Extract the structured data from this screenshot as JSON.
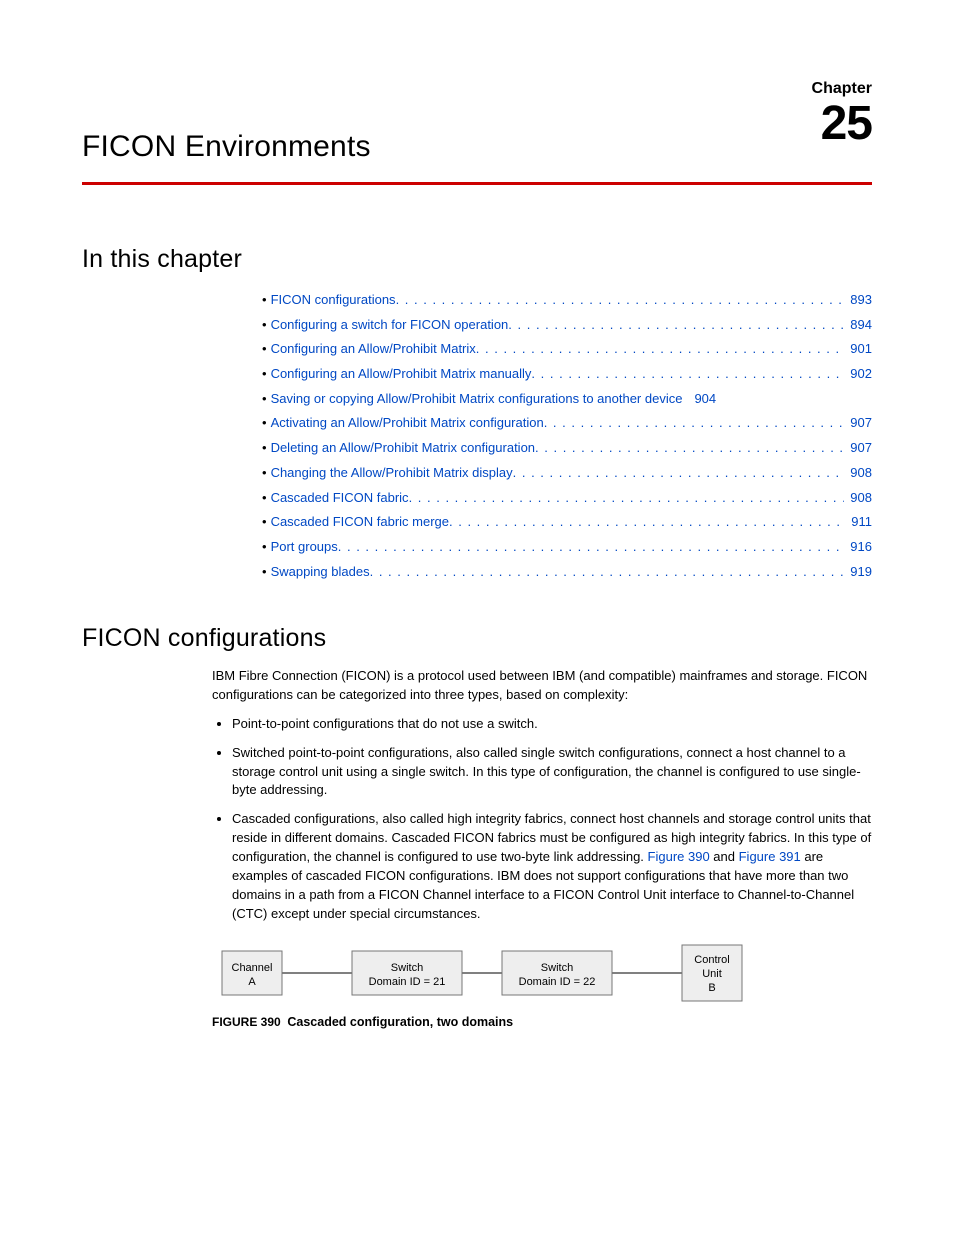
{
  "chapter": {
    "label": "Chapter",
    "number": "25",
    "title": "FICON Environments"
  },
  "toc_heading": "In this chapter",
  "toc": [
    {
      "label": "FICON configurations",
      "page": "893",
      "dots": true
    },
    {
      "label": "Configuring a switch for FICON operation",
      "page": "894",
      "dots": true
    },
    {
      "label": "Configuring an Allow/Prohibit Matrix",
      "page": "901",
      "dots": true
    },
    {
      "label": "Configuring an Allow/Prohibit Matrix manually",
      "page": "902",
      "dots": true
    },
    {
      "label": "Saving or copying Allow/Prohibit Matrix configurations to another device",
      "page": "904",
      "dots": false
    },
    {
      "label": "Activating an Allow/Prohibit Matrix configuration",
      "page": "907",
      "dots": true
    },
    {
      "label": "Deleting an Allow/Prohibit Matrix configuration",
      "page": "907",
      "dots": true
    },
    {
      "label": "Changing the Allow/Prohibit Matrix display",
      "page": "908",
      "dots": true
    },
    {
      "label": "Cascaded FICON fabric",
      "page": "908",
      "dots": true
    },
    {
      "label": "Cascaded FICON fabric merge",
      "page": "911",
      "dots": true
    },
    {
      "label": "Port groups",
      "page": "916",
      "dots": true
    },
    {
      "label": "Swapping blades",
      "page": "919",
      "dots": true
    }
  ],
  "section2_heading": "FICON configurations",
  "intro_para": "IBM Fibre Connection (FICON) is a protocol used between IBM (and compatible) mainframes and storage. FICON configurations can be categorized into three types, based on complexity:",
  "bullets": {
    "b1": "Point-to-point configurations that do not use a switch.",
    "b2": "Switched point-to-point configurations, also called single switch configurations, connect a host channel to a storage control unit using a single switch. In this type of configuration, the channel is configured to use single-byte addressing.",
    "b3_pre": "Cascaded configurations, also called high integrity fabrics, connect host channels and storage control units that reside in different domains. Cascaded FICON fabrics must be configured as high integrity fabrics. In this type of configuration, the channel is configured to use two-byte link addressing. ",
    "b3_link1": "Figure 390",
    "b3_mid": " and ",
    "b3_link2": "Figure 391",
    "b3_post": " are examples of cascaded FICON configurations. IBM does not support configurations that have more than two domains in a path from a FICON Channel interface to a FICON Control Unit interface to Channel-to-Channel (CTC) except under special circumstances."
  },
  "figure": {
    "box1_l1": "Channel",
    "box1_l2": "A",
    "box2_l1": "Switch",
    "box2_l2": "Domain ID = 21",
    "box3_l1": "Switch",
    "box3_l2": "Domain ID = 22",
    "box4_l1": "Control",
    "box4_l2": "Unit",
    "box4_l3": "B",
    "caption_label": "FIGURE 390",
    "caption_title": "Cascaded configuration, two domains"
  }
}
